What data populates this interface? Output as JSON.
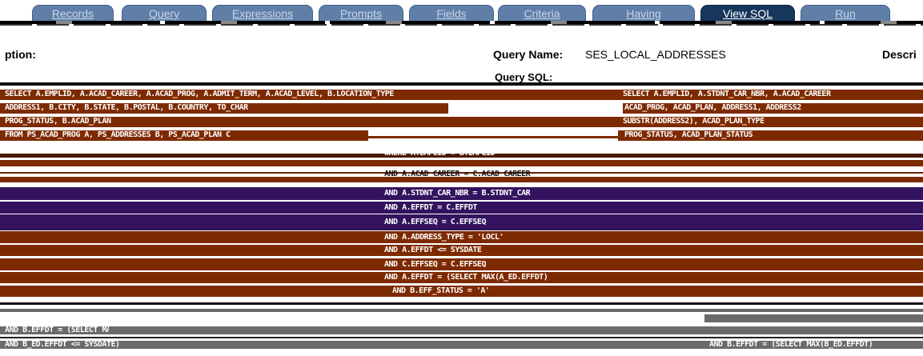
{
  "tabs": [
    {
      "label": "Records",
      "active": false
    },
    {
      "label": "Query",
      "active": false
    },
    {
      "label": "Expressions",
      "active": false
    },
    {
      "label": "Prompts",
      "active": false
    },
    {
      "label": "Fields",
      "active": false
    },
    {
      "label": "Criteria",
      "active": false
    },
    {
      "label": "Having",
      "active": false
    },
    {
      "label": "View SQL",
      "active": true
    },
    {
      "label": "Run",
      "active": false
    }
  ],
  "header": {
    "description_label": "ption:",
    "query_name_label": "Query Name:",
    "query_name_value": "SES_LOCAL_ADDRESSES",
    "description_label_right": "Descri"
  },
  "sql": {
    "label": "Query SQL:",
    "lines": [
      "SELECT A.EMPLID, A.ACAD_CAREER, A.ACAD_PROG, A.ADMIT_TERM, A.ACAD_LEVEL, B.LOCATION_TYPE",
      "ADDRESS1, B.CITY, B.STATE, B.POSTAL, B.COUNTRY, TO_CHAR",
      "PROG_STATUS, B.ACAD_PLAN",
      "FROM PS_ACAD_PROG A, PS_ADDRESSES B, PS_ACAD_PLAN C",
      "WHERE A.EMPLID = B.EMPLID",
      "AND A.ACAD_CAREER = C.ACAD_CAREER",
      "AND A.STDNT_CAR_NBR = B.STDNT_CAR",
      "AND A.EFFDT = C.EFFDT",
      "AND A.EFFSEQ = C.EFFSEQ",
      "AND A.ADDRESS_TYPE = 'LOCL'",
      "AND A.EFFDT <= SYSDATE",
      "AND C.EFFSEQ = C.EFFSEQ",
      "AND A.EFFDT = (SELECT MAX(A_ED.EFFDT)",
      "AND B.EFF_STATUS = 'A'",
      "AND B.EFFDT = (SELECT MAX(B_ED.EFFDT) FROM PS_ADDRESSES B_ED",
      "AND B_ED.EFFDT <= SYSDATE)",
      "AND B.EFFDT = (SELECT MAX(B_ED.EFFDT)"
    ],
    "right_lines": [
      "SELECT A.EMPLID, A.STDNT_CAR_NBR, A.ACAD_CAREER",
      "ACAD_PROG, ACAD_PLAN, ADDRESS1, ADDRESS2",
      "SUBSTR(ADDRESS2), ACAD_PLAN_TYPE",
      "PROG_STATUS, ACAD_PLAN_STATUS"
    ]
  }
}
